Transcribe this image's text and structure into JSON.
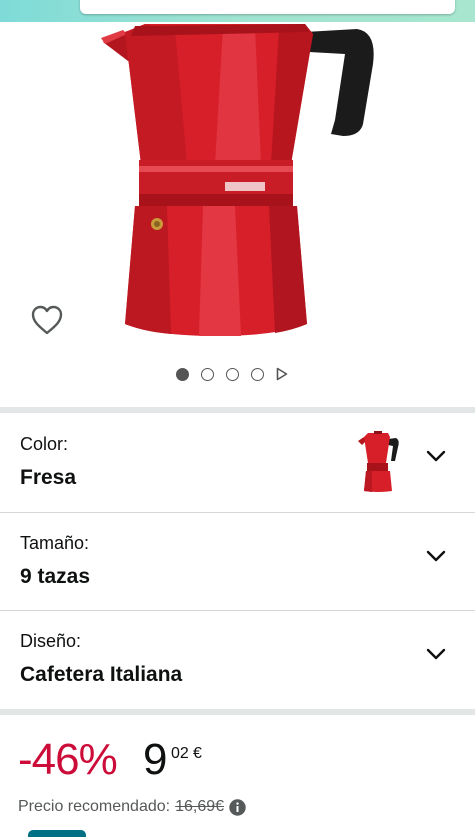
{
  "colors": {
    "accent_teal": "#7fdbd8",
    "discount_red": "#cc0c39",
    "product_red": "#d71f2a",
    "text_primary": "#0f1111",
    "text_secondary": "#565959"
  },
  "icons": {
    "wishlist": "heart-outline",
    "carousel_next": "play-triangle",
    "expand": "chevron-down",
    "info": "info-circle"
  },
  "carousel": {
    "total": 4,
    "current": 1
  },
  "variations": {
    "color": {
      "label": "Color:",
      "value": "Fresa"
    },
    "size": {
      "label": "Tamaño:",
      "value": "9 tazas"
    },
    "design": {
      "label": "Diseño:",
      "value": "Cafetera Italiana"
    }
  },
  "price": {
    "discount": "-46%",
    "whole": "9",
    "fraction": "02",
    "currency": "€",
    "rrp_label": "Precio recomendado:",
    "rrp_value": "16,69€"
  }
}
